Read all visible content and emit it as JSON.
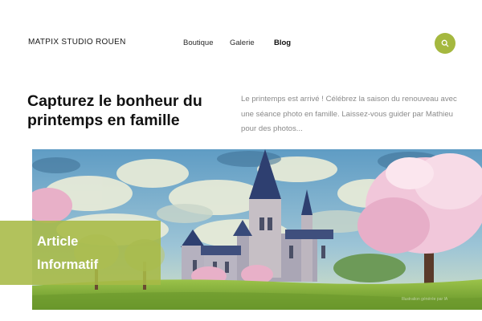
{
  "header": {
    "brand": "MATPIX STUDIO ROUEN",
    "nav": [
      {
        "label": "Boutique"
      },
      {
        "label": "Galerie"
      },
      {
        "label": "Blog"
      }
    ],
    "search_icon": "search-icon"
  },
  "main": {
    "headline": "Capturez le bonheur du printemps en famille",
    "intro": "Le printemps est arrivé ! Célébrez la saison du renouveau avec une séance photo en famille. Laissez-vous guider par Mathieu pour des photos...",
    "tag_line1": "Article",
    "tag_line2": "Informatif",
    "image_credit": "Illustration générée par IA"
  },
  "colors": {
    "accent": "#a5b83f",
    "tag_overlay": "#a7ba46"
  }
}
